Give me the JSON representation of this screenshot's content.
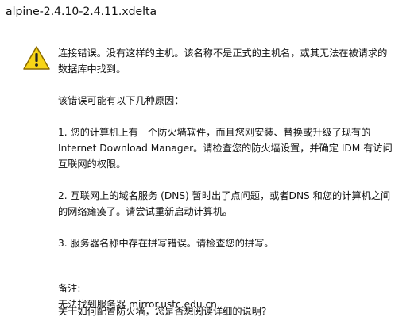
{
  "window": {
    "title": "alpine-2.4.10-2.4.11.xdelta"
  },
  "icons": {
    "warning": "warning-icon",
    "warning_fill": "#f7d417",
    "warning_stroke": "#8a6a00"
  },
  "message": {
    "p1_line1": "连接错误。没有这样的主机。该名称不是正式的主机名，或其无法在被请求的",
    "p1_line2": "数据库中找到。",
    "p2": "该错误可能有以下几种原因：",
    "p3_line1": "1. 您的计算机上有一个防火墙软件，而且您刚安装、替换或升级了现有的",
    "p3_line2": "Internet Download Manager。请检查您的防火墙设置，并确定 IDM 有访问",
    "p3_line3": "互联网的权限。",
    "p4_line1": "2. 互联网上的域名服务 (DNS) 暂时出了点问题，或者DNS 和您的计算机之间",
    "p4_line2": "的网络瘫痪了。请尝试重新启动计算机。",
    "p5": "3. 服务器名称中存在拼写错误。请检查您的拼写。",
    "note_label": "备注:",
    "note_text": "无法找到服务器 mirror.ustc.edu.cn",
    "cutoff_text": "关于如何配置防火墙，您是否想阅读详细的说明?"
  }
}
